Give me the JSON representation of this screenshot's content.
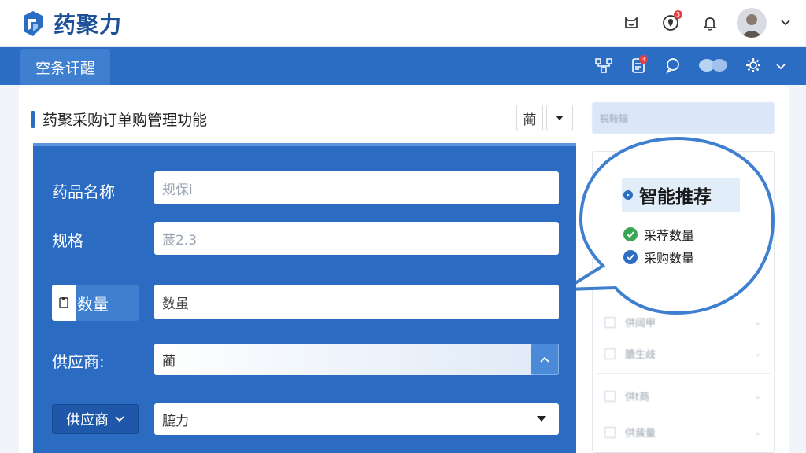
{
  "app": {
    "name": "药聚力",
    "brand_color": "#2c6dc4",
    "nav_color": "#2c6dc4"
  },
  "topbar": {
    "icons": [
      "mail-cat-icon",
      "location-alert-icon",
      "bell-icon",
      "avatar",
      "chevron-down-icon"
    ],
    "alert_badge": "3"
  },
  "nav": {
    "active_tab": "空条讦醒",
    "icons": [
      "org-chart-icon",
      "clipboard-icon",
      "chat-icon",
      "message-icon",
      "gear-icon",
      "chevron-down-icon"
    ],
    "clipboard_badge": "3"
  },
  "section": {
    "title": "药聚采购订单购管理功能",
    "action_label": "蔺"
  },
  "form": {
    "drug_name_label": "药品名称",
    "drug_name_value": "规保i",
    "spec_label": "规格",
    "spec_value": "莀2.3",
    "qty_label": "数量",
    "qty_value": "数虽",
    "supplier_label": "供应商:",
    "supplier_value": "蔺",
    "supplier_dropdown_label": "供应商",
    "supplier_select_value": "膔力"
  },
  "right_panel": {
    "search_placeholder": "锐鞍辐",
    "rows": [
      "供阔甲",
      "膔生歧",
      "供t商",
      "供蔟量"
    ]
  },
  "recommend": {
    "title": "智能推荐",
    "items": [
      {
        "label": "采荐数量",
        "color": "#3aa655"
      },
      {
        "label": "采购数量",
        "color": "#2c6dc4"
      }
    ]
  }
}
